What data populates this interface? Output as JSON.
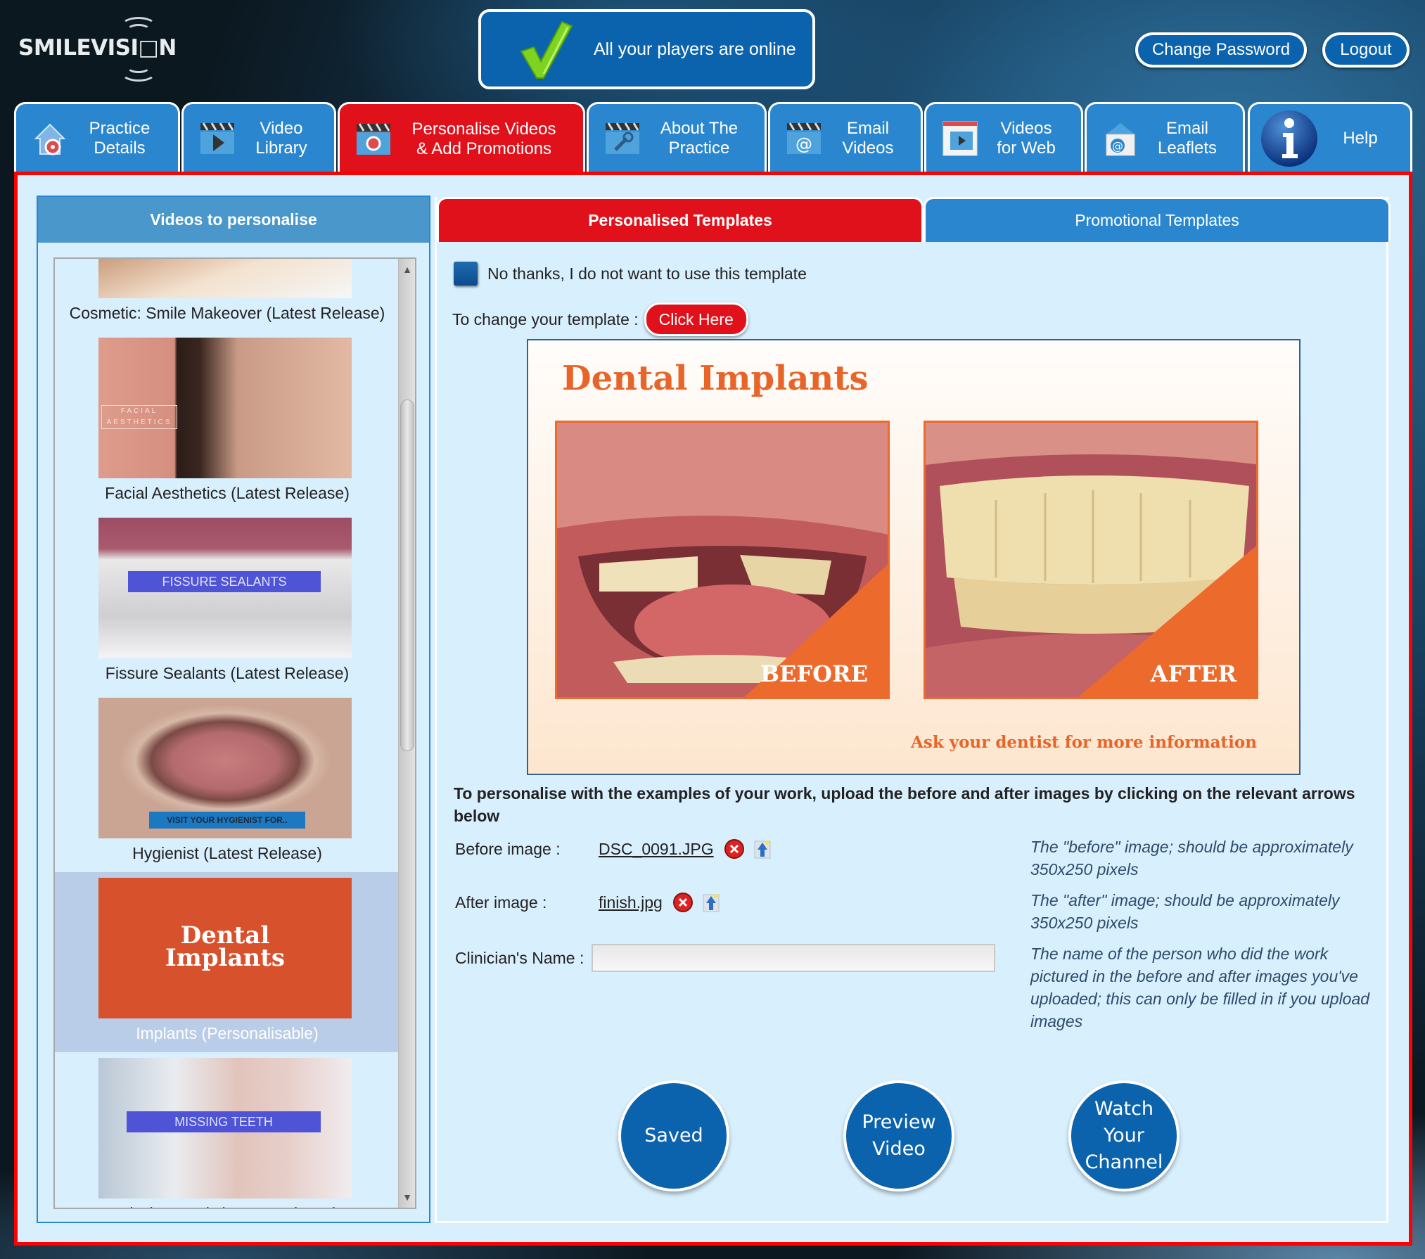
{
  "brand": {
    "logo_text": "SMILEVISI□N"
  },
  "status": {
    "text": "All your players are online",
    "icon": "check-icon"
  },
  "header_buttons": {
    "change_password": "Change Password",
    "logout": "Logout"
  },
  "tabs": [
    {
      "label": "Practice Details",
      "line1": "Practice",
      "line2": "Details",
      "icon": "house-gear-icon",
      "active": false
    },
    {
      "label": "Video Library",
      "line1": "Video",
      "line2": "Library",
      "icon": "clapper-play-icon",
      "active": false
    },
    {
      "label": "Personalise Videos & Add Promotions",
      "line1": "Personalise Videos",
      "line2": "& Add Promotions",
      "icon": "clapper-gear-icon",
      "active": true
    },
    {
      "label": "About The Practice",
      "line1": "About The",
      "line2": "Practice",
      "icon": "clapper-wrench-icon",
      "active": false
    },
    {
      "label": "Email Videos",
      "line1": "Email",
      "line2": "Videos",
      "icon": "clapper-email-icon",
      "active": false
    },
    {
      "label": "Videos for Web",
      "line1": "Videos",
      "line2": "for Web",
      "icon": "web-video-icon",
      "active": false
    },
    {
      "label": "Email Leaflets",
      "line1": "Email",
      "line2": "Leaflets",
      "icon": "envelope-email-icon",
      "active": false
    },
    {
      "label": "Help",
      "line1": "Help",
      "line2": "",
      "icon": "info-icon",
      "active": false
    }
  ],
  "left_panel": {
    "title": "Videos to personalise",
    "videos": [
      {
        "label": "Cosmetic: Smile Makeover (Latest Release)",
        "thumb_caption": "",
        "selected": false
      },
      {
        "label": "Facial Aesthetics (Latest Release)",
        "thumb_caption": "FACIAL AESTHETICS",
        "selected": false
      },
      {
        "label": "Fissure Sealants (Latest Release)",
        "thumb_caption": "FISSURE SEALANTS",
        "selected": false
      },
      {
        "label": "Hygienist (Latest Release)",
        "thumb_caption": "VISIT YOUR HYGIENIST FOR..",
        "selected": false
      },
      {
        "label": "Implants (Personalisable)",
        "thumb_caption_line1": "Dental",
        "thumb_caption_line2": "Implants",
        "selected": true
      },
      {
        "label": "Missing Teeth (Latest Release)",
        "thumb_caption": "MISSING TEETH",
        "selected": false
      }
    ]
  },
  "right_panel": {
    "tabs": {
      "personalised": "Personalised Templates",
      "promotional": "Promotional Templates",
      "active": "personalised"
    },
    "opt_out_label": "No thanks, I do not want to use this template",
    "opt_out_checked": false,
    "change_template_label": "To change your template :",
    "click_here": "Click Here",
    "template": {
      "title": "Dental Implants",
      "before_tag": "BEFORE",
      "after_tag": "AFTER",
      "footer": "Ask your dentist for more information"
    },
    "instruction": "To personalise with the examples of your work, upload the before and after images by clicking on the relevant arrows below",
    "fields": {
      "before": {
        "label": "Before image :",
        "file": "DSC_0091.JPG",
        "hint": "The \"before\" image; should be approximately 350x250 pixels"
      },
      "after": {
        "label": "After image :",
        "file": "finish.jpg",
        "hint": "The \"after\" image; should be approximately 350x250 pixels"
      },
      "clinician": {
        "label": "Clinician's Name :",
        "value": "",
        "placeholder": "",
        "hint": "The name of the person who did the work pictured in the before and after images you've uploaded; this can only be filled in if you upload images"
      }
    },
    "buttons": {
      "saved": "Saved",
      "preview": "Preview Video",
      "watch": "Watch Your Channel"
    }
  },
  "colors": {
    "brand_blue": "#0b63ad",
    "tab_blue": "#2a87cf",
    "active_red": "#e0111a",
    "panel_bg": "#d8effd",
    "template_orange": "#e8652a"
  }
}
